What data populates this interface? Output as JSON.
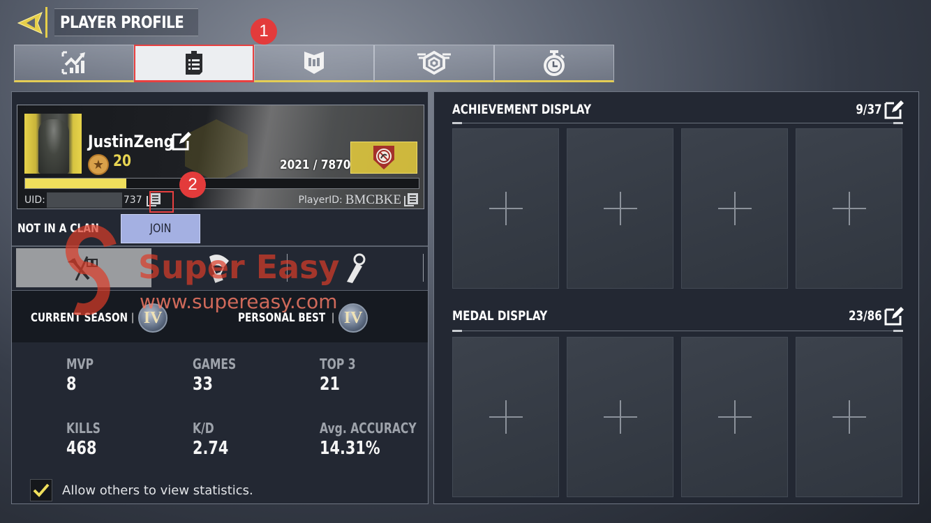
{
  "header": {
    "title": "PLAYER PROFILE"
  },
  "tabs": [
    {
      "icon": "stats-chart-icon",
      "active": false
    },
    {
      "icon": "clipboard-list-icon",
      "active": true
    },
    {
      "icon": "shield-emblem-icon",
      "active": false
    },
    {
      "icon": "winged-hexagon-icon",
      "active": false
    },
    {
      "icon": "stopwatch-icon",
      "active": false
    }
  ],
  "annotations": {
    "badge_1": "1",
    "badge_2": "2"
  },
  "profile": {
    "username": "JustinZeng",
    "level": "20",
    "xp_current": "2021 / 7870",
    "xp_progress": 0.257,
    "uid_label": "UID:",
    "uid_suffix": "737",
    "playerid_label": "PlayerID:",
    "playerid_value": "BMCBKE"
  },
  "clan": {
    "status": "NOT IN A CLAN",
    "join_label": "JOIN"
  },
  "modes": [
    {
      "name": "multiplayer",
      "active": true
    },
    {
      "name": "battle-royale",
      "active": false
    },
    {
      "name": "zombies",
      "active": false
    }
  ],
  "season": {
    "current_label": "CURRENT SEASON",
    "current_rank": "IV",
    "best_label": "PERSONAL BEST",
    "best_rank": "IV"
  },
  "stats": [
    {
      "label": "MVP",
      "value": "8"
    },
    {
      "label": "GAMES",
      "value": "33"
    },
    {
      "label": "TOP 3",
      "value": "21"
    },
    {
      "label": "KILLS",
      "value": "468"
    },
    {
      "label": "K/D",
      "value": "2.74"
    },
    {
      "label": "Avg. ACCURACY",
      "value": "14.31%"
    }
  ],
  "allow_stats": {
    "label": "Allow others to view statistics.",
    "checked": true
  },
  "achievement": {
    "title": "ACHIEVEMENT DISPLAY",
    "count": "9/37"
  },
  "medal": {
    "title": "MEDAL DISPLAY",
    "count": "23/86"
  },
  "watermark": {
    "brand": "Super Easy",
    "url": "www.supereasy.com"
  },
  "colors": {
    "accent_yellow": "#e4cd55",
    "highlight_red": "#e84040",
    "join_button": "#a4b0e2"
  }
}
